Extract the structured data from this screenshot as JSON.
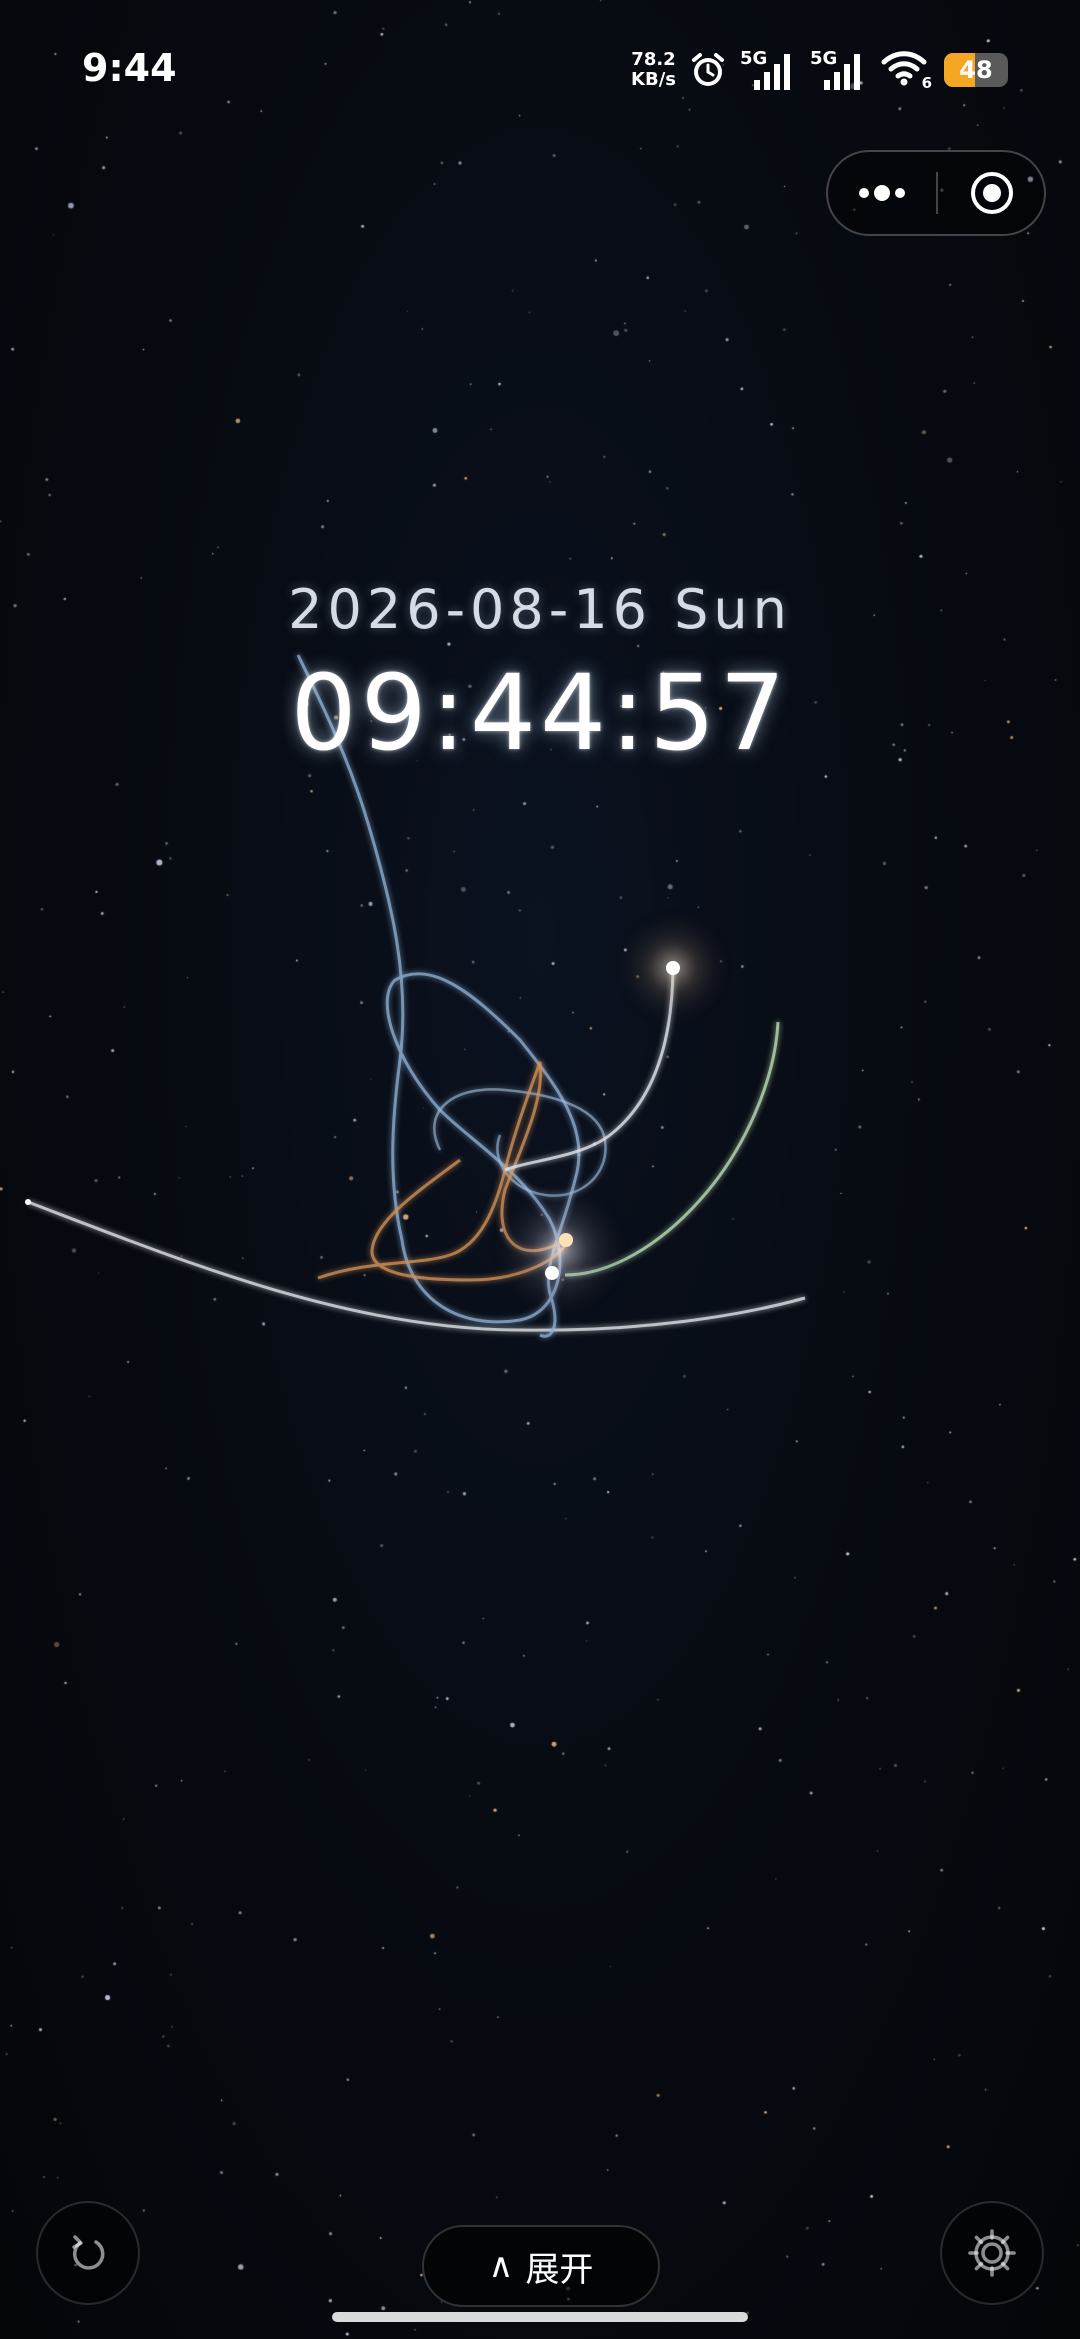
{
  "status_bar": {
    "time": "9:44",
    "net_speed_value": "78.2",
    "net_speed_unit": "KB/s",
    "sim1_tag": "5G",
    "sim2_tag": "5G",
    "wifi_tag": "6",
    "battery_level": "48",
    "battery_fraction": 0.48,
    "battery_color": "#f5a623"
  },
  "capsule": {
    "more_icon": "more-dots-icon",
    "close_icon": "target-close-icon"
  },
  "clock": {
    "date": "2026-08-16 Sun",
    "time": "09:44:57"
  },
  "controls": {
    "reset_icon": "reset-rotate-icon",
    "expand_glyph": "∧",
    "expand_label": "展开",
    "settings_icon": "gear-icon"
  },
  "colors": {
    "background": "#05070b",
    "trail_blue": "#8fb1d6",
    "trail_green": "#b7d9b0",
    "trail_orange": "#d4935a",
    "trail_white": "#e6e9ee"
  }
}
